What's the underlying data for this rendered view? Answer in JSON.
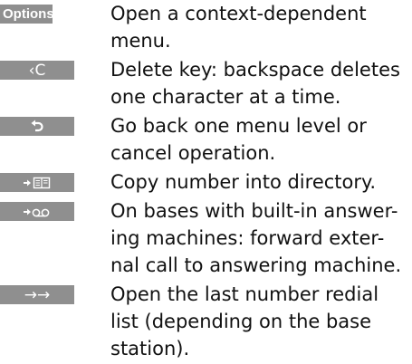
{
  "rows": [
    {
      "key": "Options",
      "lines": [
        "Open a context-dependent",
        "menu."
      ]
    },
    {
      "key": "‹C",
      "lines": [
        "Delete key: backspace deletes",
        "one character at a time."
      ]
    },
    {
      "key": "back-arrow-icon",
      "lines": [
        "Go back one menu level or",
        "cancel operation."
      ]
    },
    {
      "key": "copy-to-directory-icon",
      "lines": [
        "Copy number into directory."
      ]
    },
    {
      "key": "forward-to-answering-machine-icon",
      "lines": [
        "On bases with built-in answer-",
        "ing machines: forward exter-",
        "nal call to answering machine."
      ]
    },
    {
      "key": "→→",
      "lines": [
        "Open the last number redial",
        "list (depending on the base",
        "station)."
      ]
    }
  ]
}
